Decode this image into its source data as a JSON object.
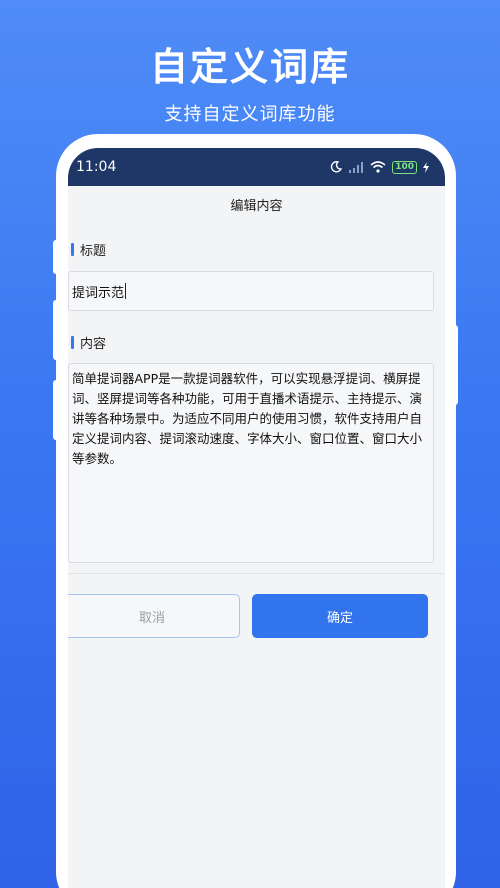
{
  "hero": {
    "title": "自定义词库",
    "subtitle": "支持自定义词库功能"
  },
  "statusbar": {
    "time": "11:04",
    "battery": "100"
  },
  "navbar": {
    "title": "编辑内容"
  },
  "form": {
    "title_label": "标题",
    "title_value": "提词示范",
    "content_label": "内容",
    "content_value": "简单提词器APP是一款提词器软件，可以实现悬浮提词、横屏提词、竖屏提词等各种功能，可用于直播术语提示、主持提示、演讲等各种场景中。为适应不同用户的使用习惯，软件支持用户自定义提词内容、提词滚动速度、字体大小、窗口位置、窗口大小等参数。"
  },
  "buttons": {
    "cancel": "取消",
    "confirm": "确定"
  },
  "colors": {
    "accent": "#3274ee",
    "statusbar": "#1f3766",
    "background_top": "#4f8cf7",
    "background_bottom": "#2f62e8"
  }
}
